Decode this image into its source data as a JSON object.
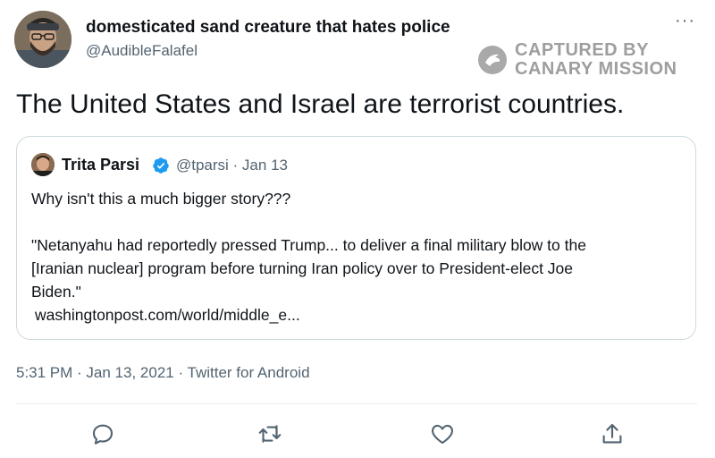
{
  "tweet": {
    "author": {
      "display_name": "domesticated sand creature that hates police",
      "handle": "@AudibleFalafel",
      "avatar": "user-avatar"
    },
    "more_icon": "more-options-icon",
    "text": "The United States and Israel are terrorist countries.",
    "quoted": {
      "author_name": "Trita Parsi",
      "verified_icon": "verified-badge-icon",
      "handle_date": "@tparsi · Jan 13",
      "line1": "Why isn't this a much bigger story???",
      "line2": "\"Netanyahu had reportedly pressed Trump... to deliver a final military blow to the",
      "line3": "[Iranian nuclear] program before turning Iran policy over to President-elect Joe",
      "line4": "Biden.\"",
      "link": "washingtonpost.com/world/middle_e..."
    },
    "meta": "5:31 PM · Jan 13, 2021 · Twitter for Android",
    "actions": [
      "reply-icon",
      "retweet-icon",
      "like-icon",
      "share-icon"
    ]
  },
  "watermark": {
    "line1": "CAPTURED BY",
    "line2": "CANARY MISSION",
    "icon": "canary-logo-icon"
  },
  "colors": {
    "text": "#0f1419",
    "secondary": "#536471",
    "verified": "#1d9bf0",
    "border": "#cfd9de",
    "watermark": "#8e8e8e"
  }
}
